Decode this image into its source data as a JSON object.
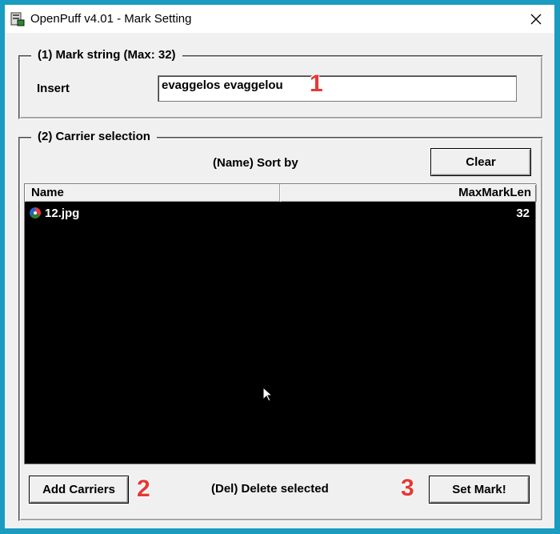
{
  "window": {
    "title": "OpenPuff v4.01 - Mark Setting"
  },
  "mark_group": {
    "legend": "(1)  Mark string (Max: 32)",
    "insert_label": "Insert",
    "insert_value": "evaggelos evaggelou"
  },
  "carrier_group": {
    "legend": "(2)  Carrier selection",
    "sort_label": "(Name) Sort by",
    "clear_button": "Clear",
    "columns": [
      "Name",
      "MaxMarkLen"
    ],
    "rows": [
      {
        "name": "12.jpg",
        "max_mark_len": "32",
        "icon": "image-file-icon"
      }
    ]
  },
  "footer": {
    "add_carriers_button": "Add Carriers",
    "delete_hint": "(Del) Delete selected",
    "set_mark_button": "Set Mark!"
  },
  "annotations": [
    "1",
    "2",
    "3"
  ],
  "colors": {
    "desktop_bg": "#1a9bc0",
    "window_bg": "#f0f0f0",
    "list_bg": "#000000",
    "annotation": "#e53935"
  }
}
